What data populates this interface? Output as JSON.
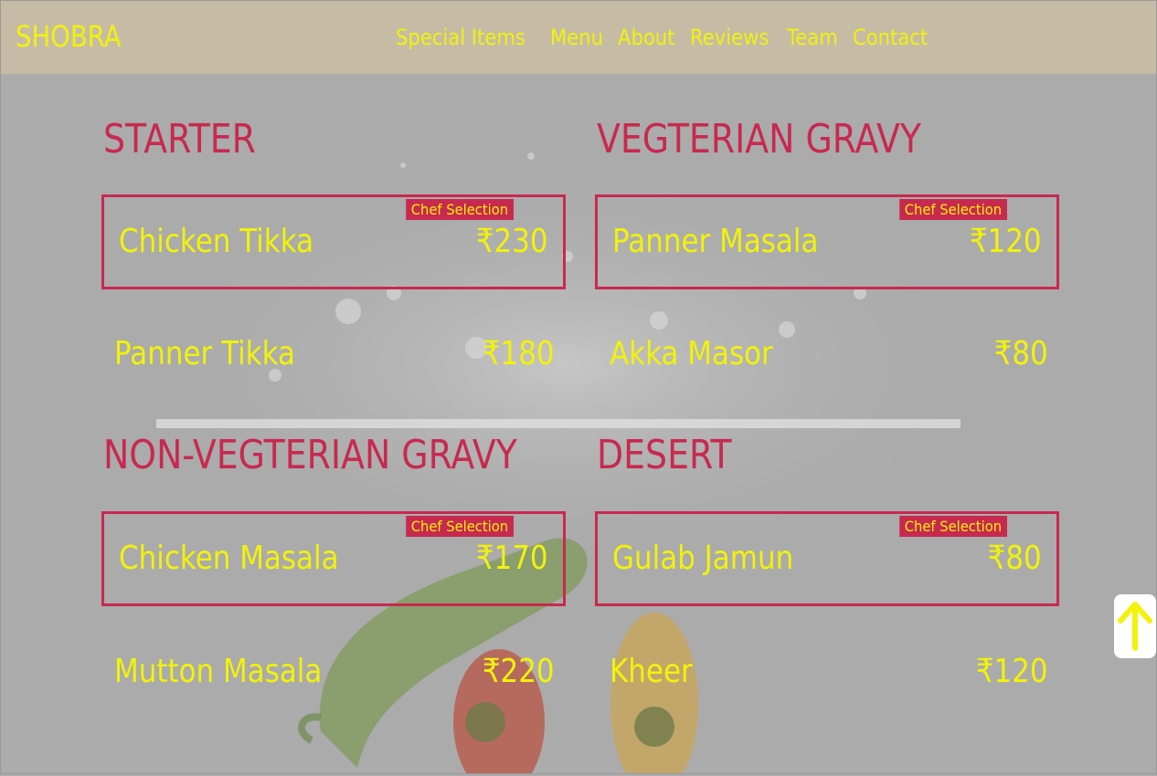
{
  "brand": "SHOBRA",
  "nav": {
    "links": [
      "Special Items",
      "Menu",
      "About",
      "Reviews",
      "Team",
      "Contact"
    ]
  },
  "colors": {
    "accent": "#c8294f",
    "text_yellow": "#f2f20a",
    "nav_bg": "#c6bca6",
    "page_bg": "#ababab"
  },
  "menu": {
    "starter": {
      "title": "STARTER",
      "featured": {
        "badge": "Chef Selection",
        "name": "Chicken Tikka",
        "price": "₹230"
      },
      "item": {
        "name": "Panner Tikka",
        "price": "₹180"
      }
    },
    "veg_gravy": {
      "title": "VEGTERIAN GRAVY",
      "featured": {
        "badge": "Chef Selection",
        "name": "Panner Masala",
        "price": "₹120"
      },
      "item": {
        "name": "Akka Masor",
        "price": "₹80"
      }
    },
    "nonveg_gravy": {
      "title": "NON-VEGTERIAN GRAVY",
      "featured": {
        "badge": "Chef Selection",
        "name": "Chicken Masala",
        "price": "₹170"
      },
      "item": {
        "name": "Mutton Masala",
        "price": "₹220"
      }
    },
    "desert": {
      "title": "DESERT",
      "featured": {
        "badge": "Chef Selection",
        "name": "Gulab Jamun",
        "price": "₹80"
      },
      "item": {
        "name": "Kheer",
        "price": "₹120"
      }
    }
  },
  "back_to_top_icon": "arrow-up-icon"
}
